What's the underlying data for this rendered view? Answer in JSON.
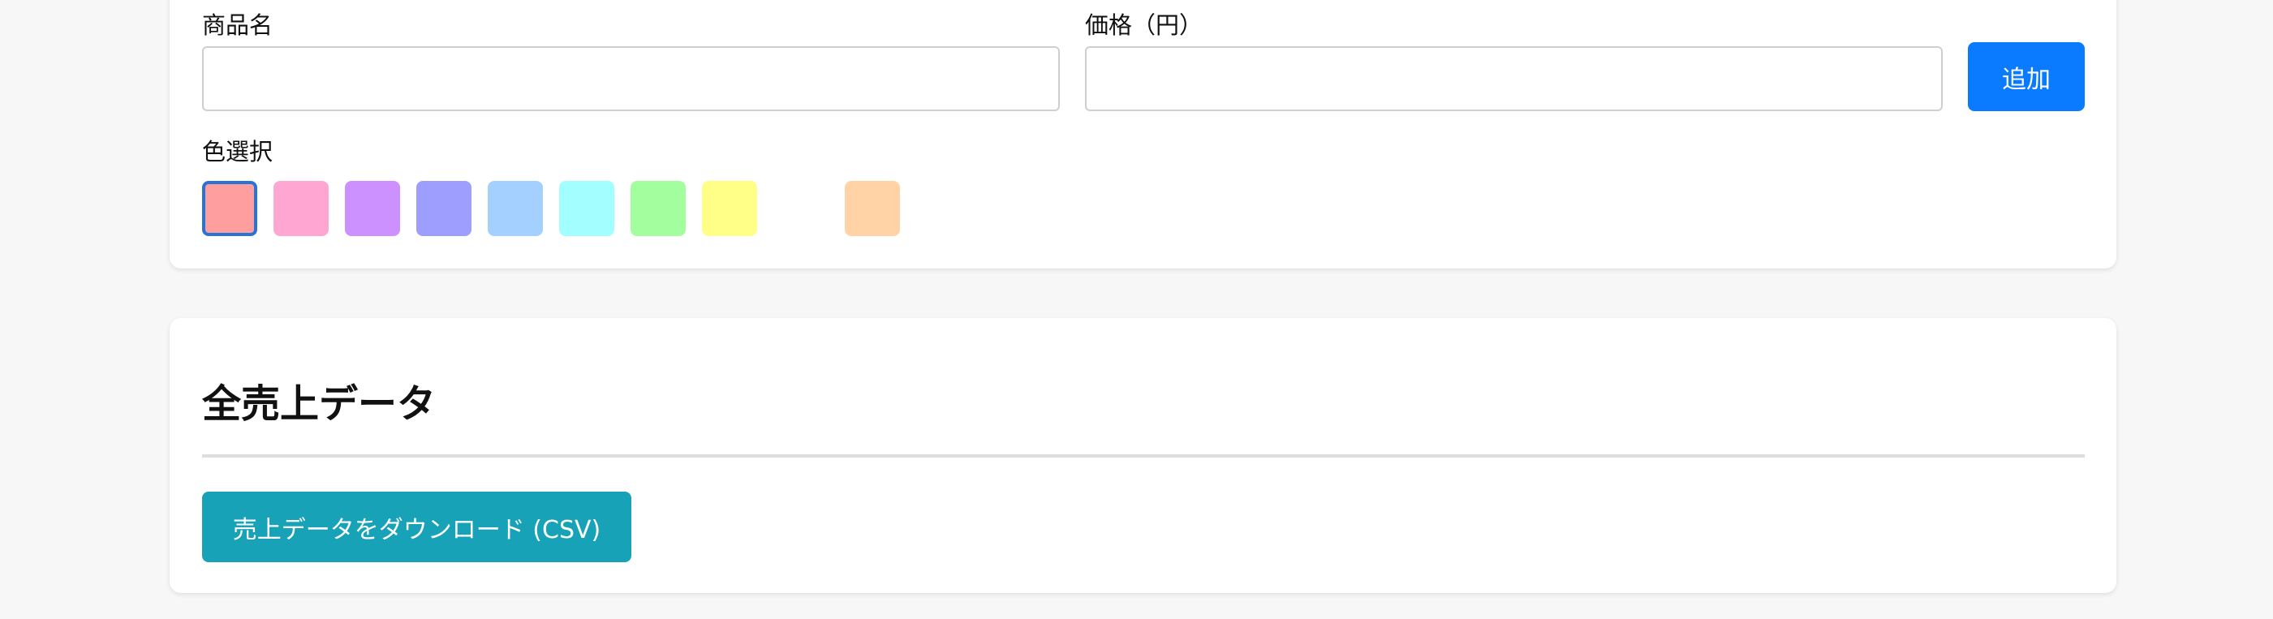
{
  "product_form": {
    "name_label": "商品名",
    "name_value": "",
    "price_label": "価格（円）",
    "price_value": "",
    "add_button": "追加",
    "color_label": "色選択",
    "colors": [
      {
        "name": "red",
        "hex": "#ff9e9e",
        "selected": true
      },
      {
        "name": "pink",
        "hex": "#ffa6d2",
        "selected": false
      },
      {
        "name": "purple",
        "hex": "#cc90ff",
        "selected": false
      },
      {
        "name": "indigo",
        "hex": "#9e9eff",
        "selected": false
      },
      {
        "name": "blue",
        "hex": "#a3d0ff",
        "selected": false
      },
      {
        "name": "cyan",
        "hex": "#a3ffff",
        "selected": false
      },
      {
        "name": "green",
        "hex": "#a3ff9e",
        "selected": false
      },
      {
        "name": "yellow",
        "hex": "#ffff87",
        "selected": false
      },
      {
        "name": "white",
        "hex": "#ffffff",
        "selected": false
      },
      {
        "name": "orange",
        "hex": "#ffd3a6",
        "selected": false
      }
    ]
  },
  "sales_section": {
    "title": "全売上データ",
    "download_button": "売上データをダウンロード (CSV)"
  },
  "colors": {
    "primary": "#0a7bff",
    "info": "#17a2b8",
    "selected_border": "#2a73d6"
  }
}
